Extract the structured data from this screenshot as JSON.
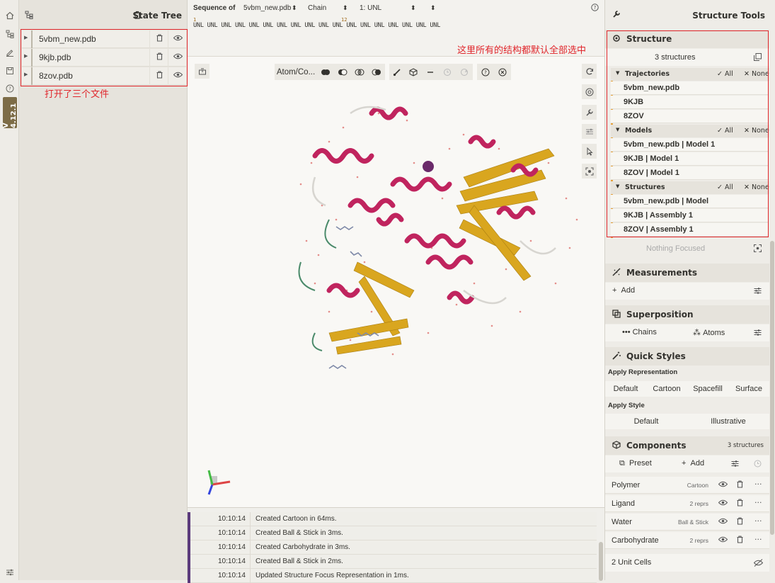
{
  "rail": {
    "version": "V 4.12.1"
  },
  "state_tree": {
    "title": "State Tree",
    "files": [
      {
        "name": "5vbm_new.pdb"
      },
      {
        "name": "9kjb.pdb"
      },
      {
        "name": "8zov.pdb"
      }
    ],
    "annotation": "打开了三个文件"
  },
  "sequence": {
    "label": "Sequence of",
    "structure_select": "5vbm_new.pdb",
    "chain_select": "Chain",
    "entity_select": "1: UNL",
    "residues": "UNL UNL UNL UNL UNL UNL UNL UNL UNL UNL UNL UNL UNL UNL UNL UNL UNL UNL",
    "marker_1": "1",
    "marker_12": "12"
  },
  "viewport": {
    "mode_select": "Atom/Co...",
    "annotation": "这里所有的结构都默认全部选中"
  },
  "log": [
    {
      "time": "10:10:14",
      "msg": "Created Cartoon in 64ms."
    },
    {
      "time": "10:10:14",
      "msg": "Created Ball & Stick in 3ms."
    },
    {
      "time": "10:10:14",
      "msg": "Created Carbohydrate in 3ms."
    },
    {
      "time": "10:10:14",
      "msg": "Created Ball & Stick in 2ms."
    },
    {
      "time": "10:10:14",
      "msg": "Updated Structure Focus Representation in 1ms."
    }
  ],
  "right": {
    "title": "Structure Tools",
    "structure": {
      "heading": "Structure",
      "count": "3 structures",
      "all_label": "All",
      "none_label": "None",
      "groups": [
        {
          "label": "Trajectories",
          "items": [
            "5vbm_new.pdb",
            "9KJB",
            "8ZOV"
          ]
        },
        {
          "label": "Models",
          "items": [
            "5vbm_new.pdb | Model 1",
            "9KJB | Model 1",
            "8ZOV | Model 1"
          ]
        },
        {
          "label": "Structures",
          "items": [
            "5vbm_new.pdb | Model",
            "9KJB | Assembly 1",
            "8ZOV | Assembly 1"
          ]
        }
      ],
      "focus": "Nothing Focused"
    },
    "measurements": {
      "heading": "Measurements",
      "add": "Add"
    },
    "superposition": {
      "heading": "Superposition",
      "chains": "Chains",
      "atoms": "Atoms"
    },
    "quick_styles": {
      "heading": "Quick Styles",
      "apply_repr": "Apply Representation",
      "repr_buttons": [
        "Default",
        "Cartoon",
        "Spacefill",
        "Surface"
      ],
      "apply_style": "Apply Style",
      "style_buttons": [
        "Default",
        "Illustrative"
      ]
    },
    "components": {
      "heading": "Components",
      "count": "3 structures",
      "preset": "Preset",
      "add": "Add",
      "rows": [
        {
          "name": "Polymer",
          "repr": "Cartoon"
        },
        {
          "name": "Ligand",
          "repr": "2 reprs"
        },
        {
          "name": "Water",
          "repr": "Ball & Stick"
        },
        {
          "name": "Carbohydrate",
          "repr": "2 reprs"
        }
      ],
      "unit_cells": "2 Unit Cells"
    }
  }
}
